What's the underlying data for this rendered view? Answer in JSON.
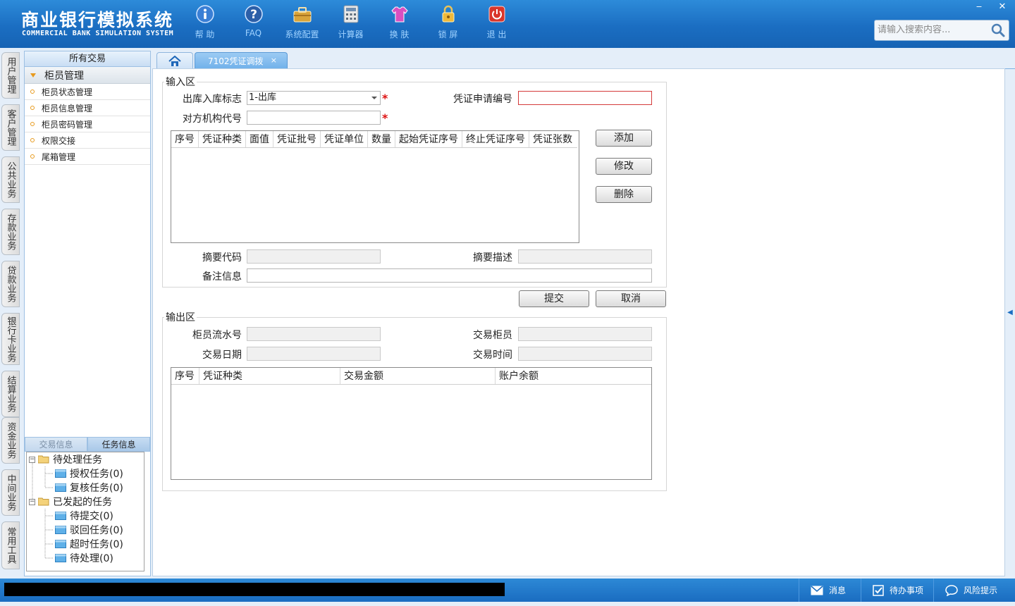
{
  "app": {
    "title_cn": "商业银行模拟系统",
    "title_en": "COMMERCIAL BANK SIMULATION SYSTEM"
  },
  "toolbar": [
    {
      "label": "帮 助",
      "icon": "info-icon"
    },
    {
      "label": "FAQ",
      "icon": "question-icon"
    },
    {
      "label": "系统配置",
      "icon": "toolbox-icon"
    },
    {
      "label": "计算器",
      "icon": "calculator-icon"
    },
    {
      "label": "换 肤",
      "icon": "shirt-icon"
    },
    {
      "label": "锁 屏",
      "icon": "lock-icon"
    },
    {
      "label": "退 出",
      "icon": "power-icon"
    }
  ],
  "window": {
    "minimize": "‒",
    "close": "✕"
  },
  "search": {
    "placeholder": "请输入搜索内容..."
  },
  "vtabs": [
    "用户管理",
    "客户管理",
    "公共业务",
    "存款业务",
    "贷款业务",
    "银行卡业务",
    "结算业务",
    "资金业务",
    "中间业务",
    "常用工具"
  ],
  "left_panel": {
    "header": "所有交易",
    "group": "柜员管理",
    "items": [
      "柜员状态管理",
      "柜员信息管理",
      "柜员密码管理",
      "权限交接",
      "尾箱管理"
    ],
    "task_tabs": [
      "交易信息",
      "任务信息"
    ],
    "tree": {
      "pending": "待处理任务",
      "pending_children": [
        "授权任务(0)",
        "复核任务(0)"
      ],
      "started": "已发起的任务",
      "started_children": [
        "待提交(0)",
        "驳回任务(0)",
        "超时任务(0)",
        "待处理(0)"
      ]
    }
  },
  "tabs": {
    "active": "7102凭证调拨",
    "close": "×"
  },
  "input_area": {
    "legend": "输入区",
    "direction_label": "出库入库标志",
    "direction_value": "1-出库",
    "apply_no_label": "凭证申请编号",
    "apply_no_value": "",
    "counterparty_label": "对方机构代号",
    "counterparty_value": "",
    "required_mark": "*",
    "grid_headers": [
      "序号",
      "凭证种类",
      "面值",
      "凭证批号",
      "凭证单位",
      "数量",
      "起始凭证序号",
      "终止凭证序号",
      "凭证张数"
    ],
    "add_btn": "添加",
    "modify_btn": "修改",
    "delete_btn": "删除",
    "summary_code_label": "摘要代码",
    "summary_desc_label": "摘要描述",
    "remark_label": "备注信息"
  },
  "actions": {
    "submit": "提交",
    "cancel": "取消"
  },
  "output_area": {
    "legend": "输出区",
    "teller_serial_label": "柜员流水号",
    "trade_teller_label": "交易柜员",
    "trade_date_label": "交易日期",
    "trade_time_label": "交易时间",
    "grid_headers": [
      "序号",
      "凭证种类",
      "交易金额",
      "账户余额"
    ]
  },
  "statusbar": {
    "message": "消息",
    "todo": "待办事项",
    "risk": "风险提示"
  },
  "colors": {
    "header_blue": "#1b6ec2",
    "accent_orange": "#e79a1e",
    "required_red": "#d11111"
  }
}
